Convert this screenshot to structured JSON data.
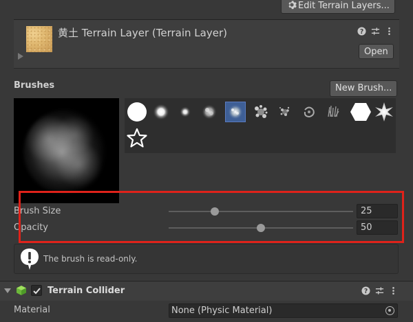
{
  "toolbar": {
    "edit_terrain_layers_label": "Edit Terrain Layers..."
  },
  "terrain_layer": {
    "title": "黄土 Terrain Layer (Terrain Layer)",
    "open_label": "Open"
  },
  "brushes": {
    "section_label": "Brushes",
    "new_brush_label": "New Brush...",
    "palette": [
      {
        "icon": "hard-circle-brush-icon",
        "selected": false
      },
      {
        "icon": "soft-circle-brush-icon",
        "selected": false
      },
      {
        "icon": "small-soft-brush-icon",
        "selected": false
      },
      {
        "icon": "cloud-brush-icon",
        "selected": false
      },
      {
        "icon": "noise-brush-icon",
        "selected": true
      },
      {
        "icon": "splatter-brush-icon",
        "selected": false
      },
      {
        "icon": "speckle-brush-icon",
        "selected": false
      },
      {
        "icon": "ring-brush-icon",
        "selected": false
      },
      {
        "icon": "grass-brush-icon",
        "selected": false
      },
      {
        "icon": "hexagon-brush-icon",
        "selected": false
      },
      {
        "icon": "starburst-brush-icon",
        "selected": false
      },
      {
        "icon": "star-outline-brush-icon",
        "selected": false
      }
    ]
  },
  "brush_size": {
    "label": "Brush Size",
    "value": "25",
    "slider_fraction": 0.25
  },
  "opacity": {
    "label": "Opacity",
    "value": "50",
    "slider_fraction": 0.5
  },
  "info_box": {
    "message": "The brush is read-only."
  },
  "terrain_collider": {
    "title": "Terrain Collider",
    "enabled": true,
    "material_label": "Material",
    "material_value": "None (Physic Material)"
  },
  "colors": {
    "background": "#383838",
    "selected_brush": "#3e5f96",
    "highlight_box": "#e0221a"
  }
}
